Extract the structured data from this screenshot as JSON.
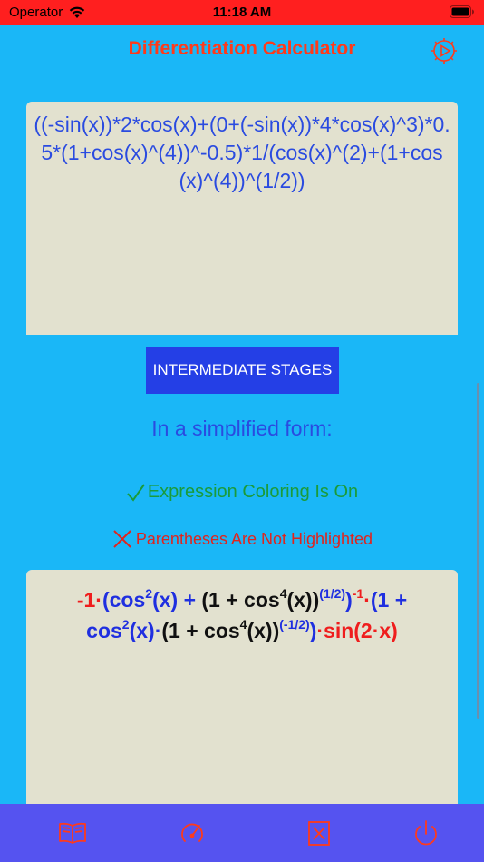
{
  "status_bar": {
    "carrier": "Operator",
    "time": "11:18 AM"
  },
  "header": {
    "title": "Differentiation Calculator",
    "settings_icon": "gear-play-icon"
  },
  "input": {
    "expression": "((-sin(x))*2*cos(x)+(0+(-sin(x))*4*cos(x)^3)*0.5*(1+cos(x)^(4))^-0.5)*1/(cos(x)^(2)+(1+cos(x)^(4))^(1/2))"
  },
  "actions": {
    "intermediate_stages_label": "INTERMEDIATE STAGES"
  },
  "labels": {
    "simplified": "In a simplified form:",
    "coloring_status": "Expression Coloring Is On",
    "parentheses_status": "Parentheses Are Not Highlighted"
  },
  "result": {
    "p1": "-1·",
    "p2": "(cos",
    "e2a": "2",
    "p3": "(x) + ",
    "p4": "(1 + cos",
    "e4a": "4",
    "p5": "(x))",
    "e_half": "(1/2)",
    "p6": ")",
    "e_neg1": "-1",
    "p7": "·",
    "p8": "(1 +",
    "p9": "cos",
    "e2b": "2",
    "p10": "(x)·",
    "p11": "(1 + cos",
    "e4b": "4",
    "p12": "(x))",
    "e_neghalf": "(-1/2)",
    "p13": ")",
    "p14": "·sin(2·x)"
  },
  "toolbar": {
    "icons": [
      "book-icon",
      "gauge-icon",
      "clear-box-icon",
      "power-icon"
    ]
  },
  "colors": {
    "background": "#1ab7f7",
    "status_bar": "#ff1f1f",
    "title": "#ff3a1a",
    "panel": "#e2e1cf",
    "button": "#243fe6",
    "toolbar": "#5553f0",
    "success": "#1a9b3a",
    "error": "#e0241e"
  }
}
